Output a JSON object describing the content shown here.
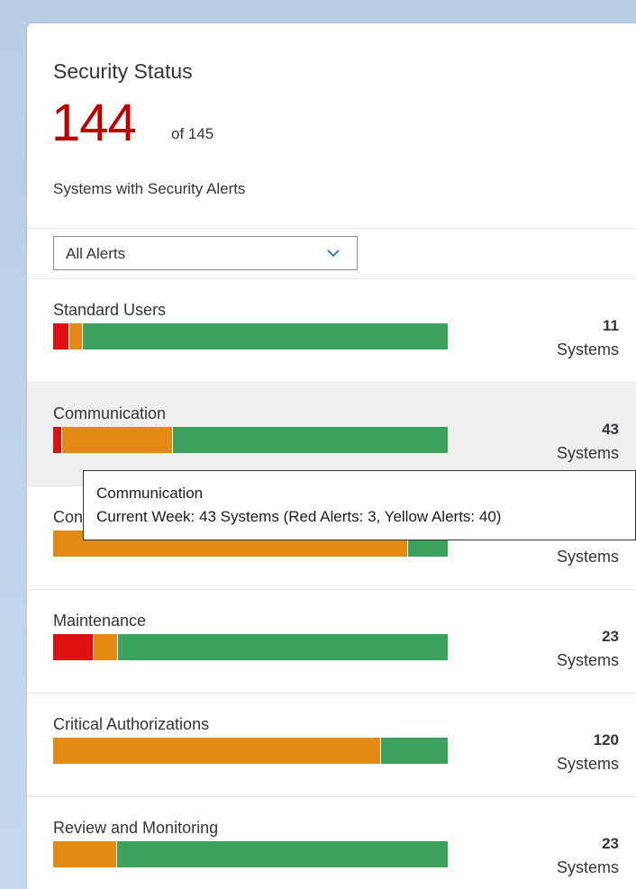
{
  "card": {
    "title": "Security Status",
    "kpi_value": "144",
    "kpi_of": "of 145",
    "subtitle": "Systems with Security Alerts"
  },
  "filter": {
    "selected": "All Alerts"
  },
  "colors": {
    "red": "#dd1111",
    "yellow": "#e38a14",
    "green": "#3ca35e",
    "kpi": "#bb0000"
  },
  "rows": [
    {
      "label": "Standard Users",
      "count": "11",
      "unit": "Systems",
      "segments": {
        "red": 4,
        "yellow": 3,
        "green": 93
      }
    },
    {
      "label": "Communication",
      "count": "43",
      "unit": "Systems",
      "segments": {
        "red": 2,
        "yellow": 28,
        "green": 70
      }
    },
    {
      "label": "Configuration",
      "count": "",
      "unit": "Systems",
      "segments": {
        "red": 0,
        "yellow": 90,
        "green": 10
      }
    },
    {
      "label": "Maintenance",
      "count": "23",
      "unit": "Systems",
      "segments": {
        "red": 10,
        "yellow": 6,
        "green": 84
      }
    },
    {
      "label": "Critical Authorizations",
      "count": "120",
      "unit": "Systems",
      "segments": {
        "red": 0,
        "yellow": 83,
        "green": 17
      }
    },
    {
      "label": "Review and Monitoring",
      "count": "23",
      "unit": "Systems",
      "segments": {
        "red": 0,
        "yellow": 16,
        "green": 84
      }
    }
  ],
  "tooltip": {
    "title": "Communication",
    "text": "Current Week: 43 Systems (Red Alerts: 3, Yellow Alerts: 40)"
  }
}
